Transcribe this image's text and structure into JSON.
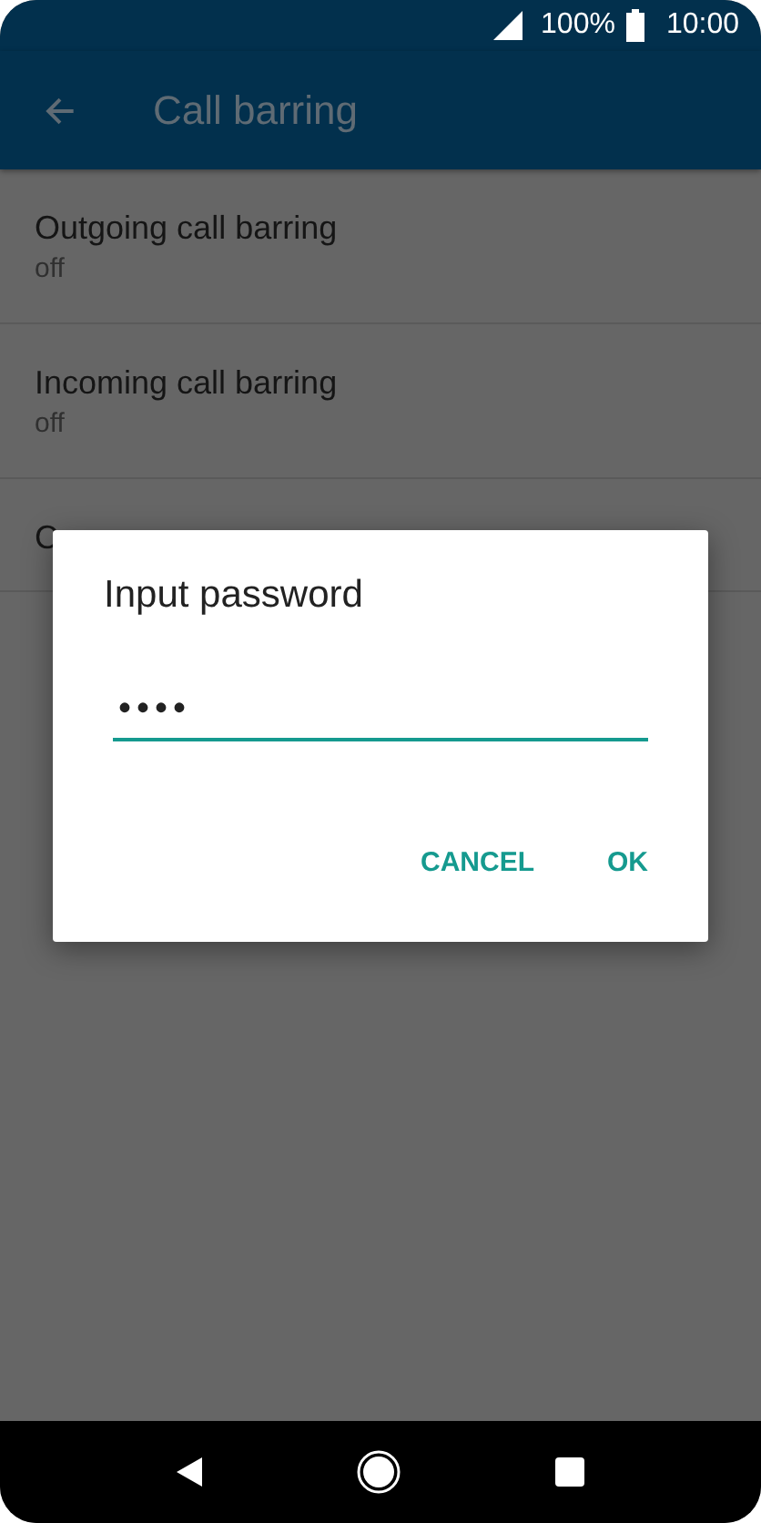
{
  "status_bar": {
    "battery": "100%",
    "time": "10:00"
  },
  "app_bar": {
    "title": "Call barring"
  },
  "items": [
    {
      "title": "Outgoing call barring",
      "subtitle": "off"
    },
    {
      "title": "Incoming call barring",
      "subtitle": "off"
    },
    {
      "title": "C"
    }
  ],
  "dialog": {
    "title": "Input password",
    "value": "••••",
    "buttons": [
      "CANCEL",
      "OK"
    ]
  }
}
